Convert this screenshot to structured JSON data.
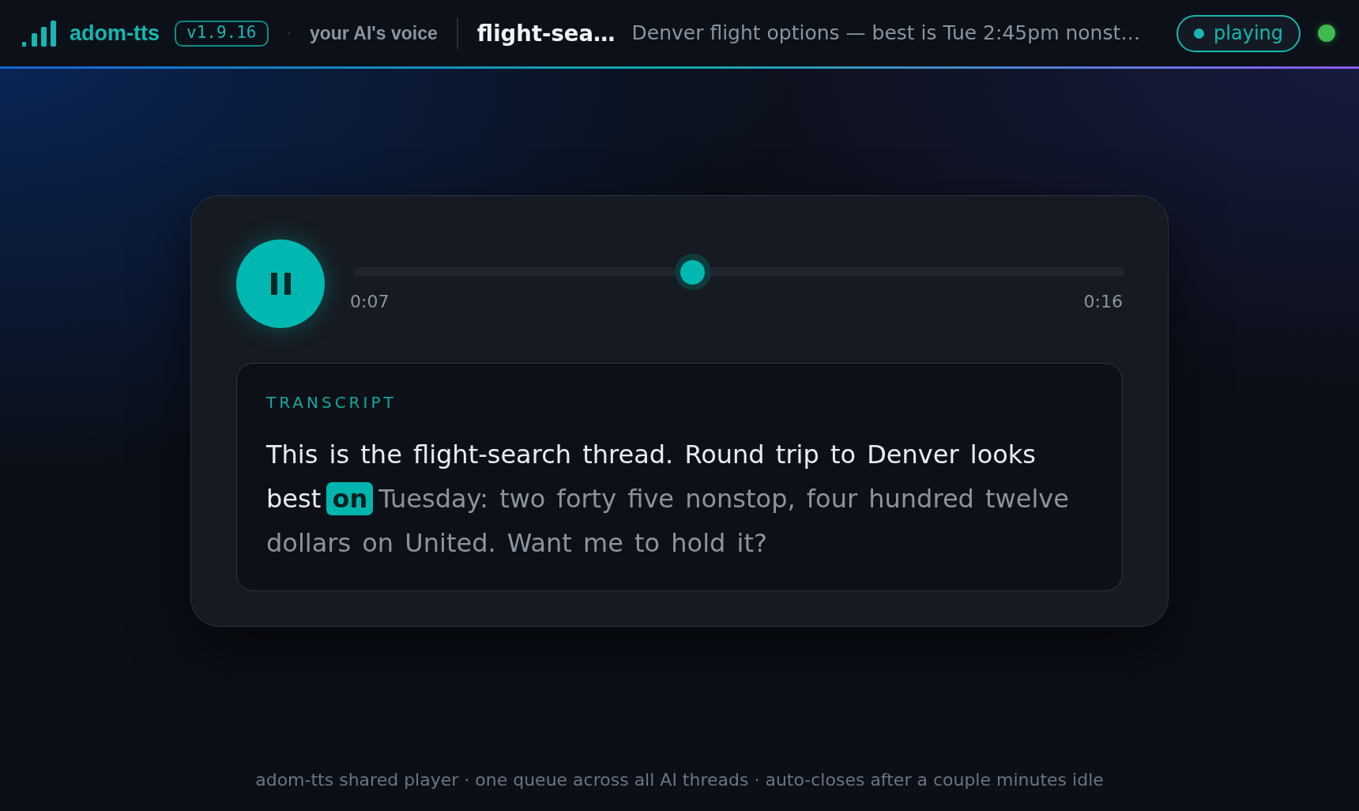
{
  "header": {
    "app_name": "adom-tts",
    "version": "v1.9.16",
    "separator": "·",
    "tagline": "your AI's voice",
    "thread_title": "flight-sea…",
    "thread_summary": "Denver flight options — best is Tue 2:45pm nonst…",
    "status": "playing"
  },
  "player": {
    "playing": true,
    "progress": {
      "level": 0.44
    },
    "elapsed": "0:07",
    "duration": "0:16"
  },
  "transcript": {
    "label": "TRANSCRIPT",
    "segments": [
      {
        "kind": "spoken",
        "text": "This is the flight-search thread. Round trip to Denver looks best"
      },
      {
        "kind": "current",
        "text": "on"
      },
      {
        "kind": "upcoming",
        "text": "Tuesday: two forty five nonstop, four hundred twelve dollars on United. Want me to hold it?"
      }
    ]
  },
  "footer": "adom-tts shared player · one queue across all AI threads · auto-closes after a couple minutes idle"
}
